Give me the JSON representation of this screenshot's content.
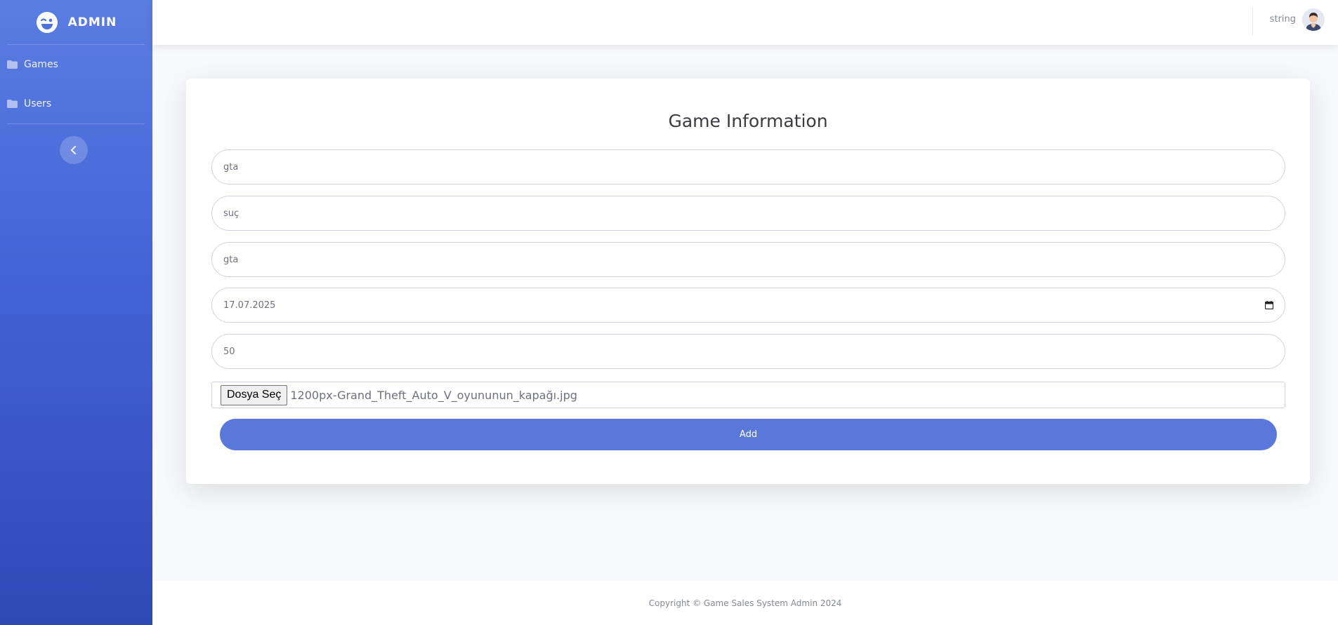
{
  "sidebar": {
    "brand": "ADMIN",
    "items": [
      {
        "label": "Games",
        "icon": "folder-icon"
      },
      {
        "label": "Users",
        "icon": "folder-icon"
      }
    ],
    "toggle_icon": "chevron-left-icon"
  },
  "topbar": {
    "user_name": "string",
    "avatar_icon": "user-avatar"
  },
  "form": {
    "title": "Game Information",
    "fields": {
      "name": "gta",
      "category": "suç",
      "description": "gta",
      "release_date": "17.07.2025",
      "price": "50"
    },
    "file_button": "Dosya Seç",
    "file_name": "1200px-Grand_Theft_Auto_V_oyununun_kapağı.jpg",
    "submit_label": "Add"
  },
  "footer": {
    "copyright": "Copyright © Game Sales System Admin 2024"
  },
  "colors": {
    "sidebar_top": "#5a7de2",
    "sidebar_bottom": "#2f49b6",
    "primary_button": "#5a78dc"
  }
}
